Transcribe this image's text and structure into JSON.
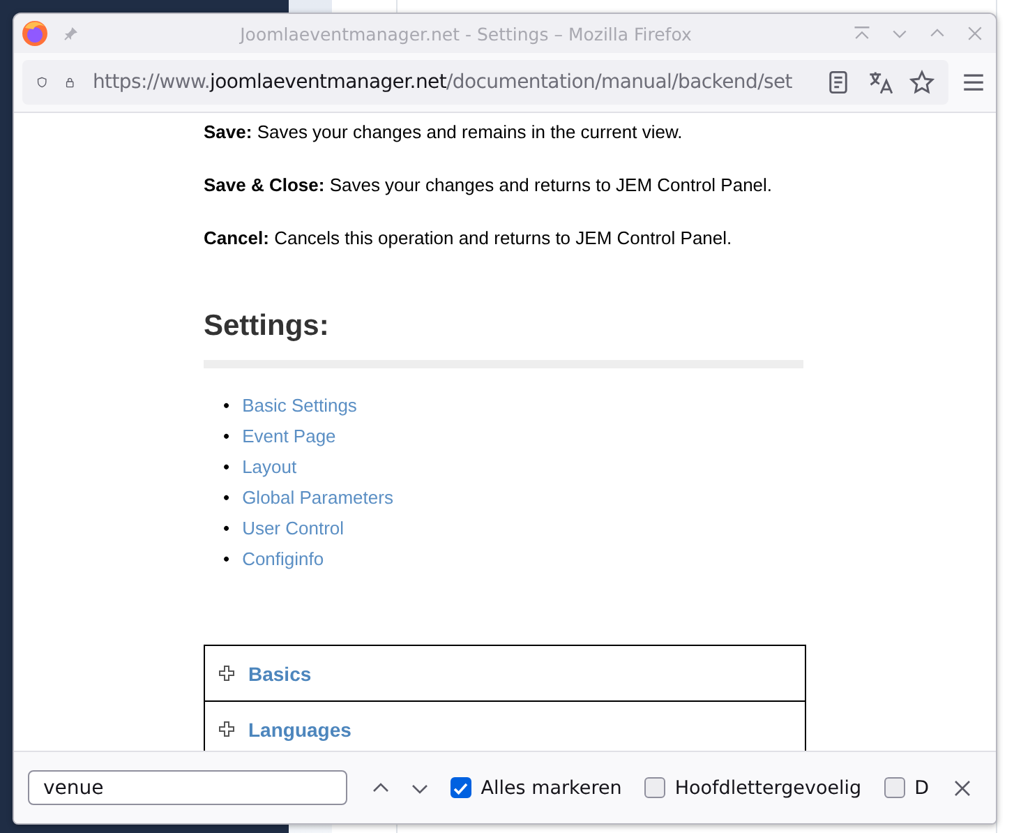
{
  "window": {
    "title": "Joomlaeventmanager.net - Settings – Mozilla Firefox"
  },
  "address_bar": {
    "scheme": "https://www.",
    "domain": "joomlaeventmanager.net",
    "path": "/documentation/manual/backend/set"
  },
  "content": {
    "paragraphs": [
      "**Save:** Saves your changes and remains in the current view.",
      "**Save & Close:** Saves your changes and returns to JEM Control Panel.",
      "**Cancel:** Cancels this operation and returns to JEM Control Panel."
    ],
    "heading": "Settings:",
    "links": [
      {
        "marker": "•",
        "label": "Basic Settings"
      },
      {
        "marker": "•",
        "label": "Event Page"
      },
      {
        "marker": "•",
        "label": "Layout"
      },
      {
        "marker": "•",
        "label": "Global Parameters"
      },
      {
        "marker": "•",
        "label": "User Control"
      },
      {
        "marker": "•",
        "label": "Configinfo"
      }
    ],
    "accordion": [
      {
        "label": "Basics",
        "expanded": false
      },
      {
        "label": "Languages",
        "expanded": false
      }
    ]
  },
  "find_bar": {
    "value": "venue",
    "options": [
      {
        "label": "Alles markeren",
        "checked": true
      },
      {
        "label": "Hoofdlettergevoelig",
        "checked": false
      },
      {
        "label": "D",
        "checked": false
      }
    ]
  }
}
